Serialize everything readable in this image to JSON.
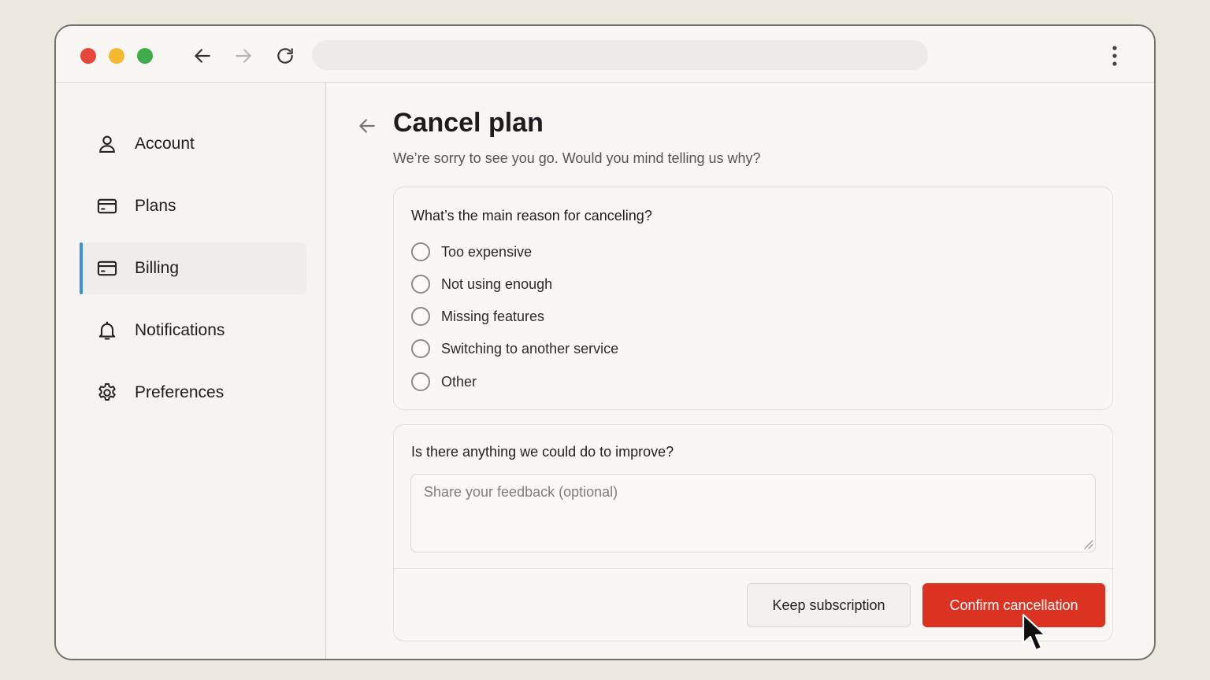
{
  "browser": {
    "traffic_lights": [
      "#e5473b",
      "#f5b92f",
      "#3fae4a"
    ],
    "address_value": "",
    "icons": [
      "back-arrow-icon",
      "forward-arrow-icon",
      "reload-icon",
      "more-vertical-icon"
    ]
  },
  "sidebar": {
    "items": [
      {
        "label": "Account",
        "icon": "user-icon",
        "active": false
      },
      {
        "label": "Plans",
        "icon": "card-icon",
        "active": false
      },
      {
        "label": "Billing",
        "icon": "card-icon",
        "active": true
      },
      {
        "label": "Notifications",
        "icon": "bell-icon",
        "active": false
      },
      {
        "label": "Preferences",
        "icon": "gear-icon",
        "active": false
      }
    ],
    "active_accent": "#3b8ee0"
  },
  "main": {
    "title": "Cancel plan",
    "subtitle": "We’re sorry to see you go. Would you mind telling us why?",
    "reason_card": {
      "question": "What’s the main reason for canceling?",
      "options": [
        "Too expensive",
        "Not using enough",
        "Missing features",
        "Switching to another service",
        "Other"
      ]
    },
    "feedback_card": {
      "question": "Is there anything we could do to improve?",
      "placeholder": "Share your feedback (optional)",
      "value": ""
    },
    "actions": {
      "keep_label": "Keep subscription",
      "confirm_label": "Confirm cancellation",
      "confirm_color": "#dc3222"
    }
  }
}
